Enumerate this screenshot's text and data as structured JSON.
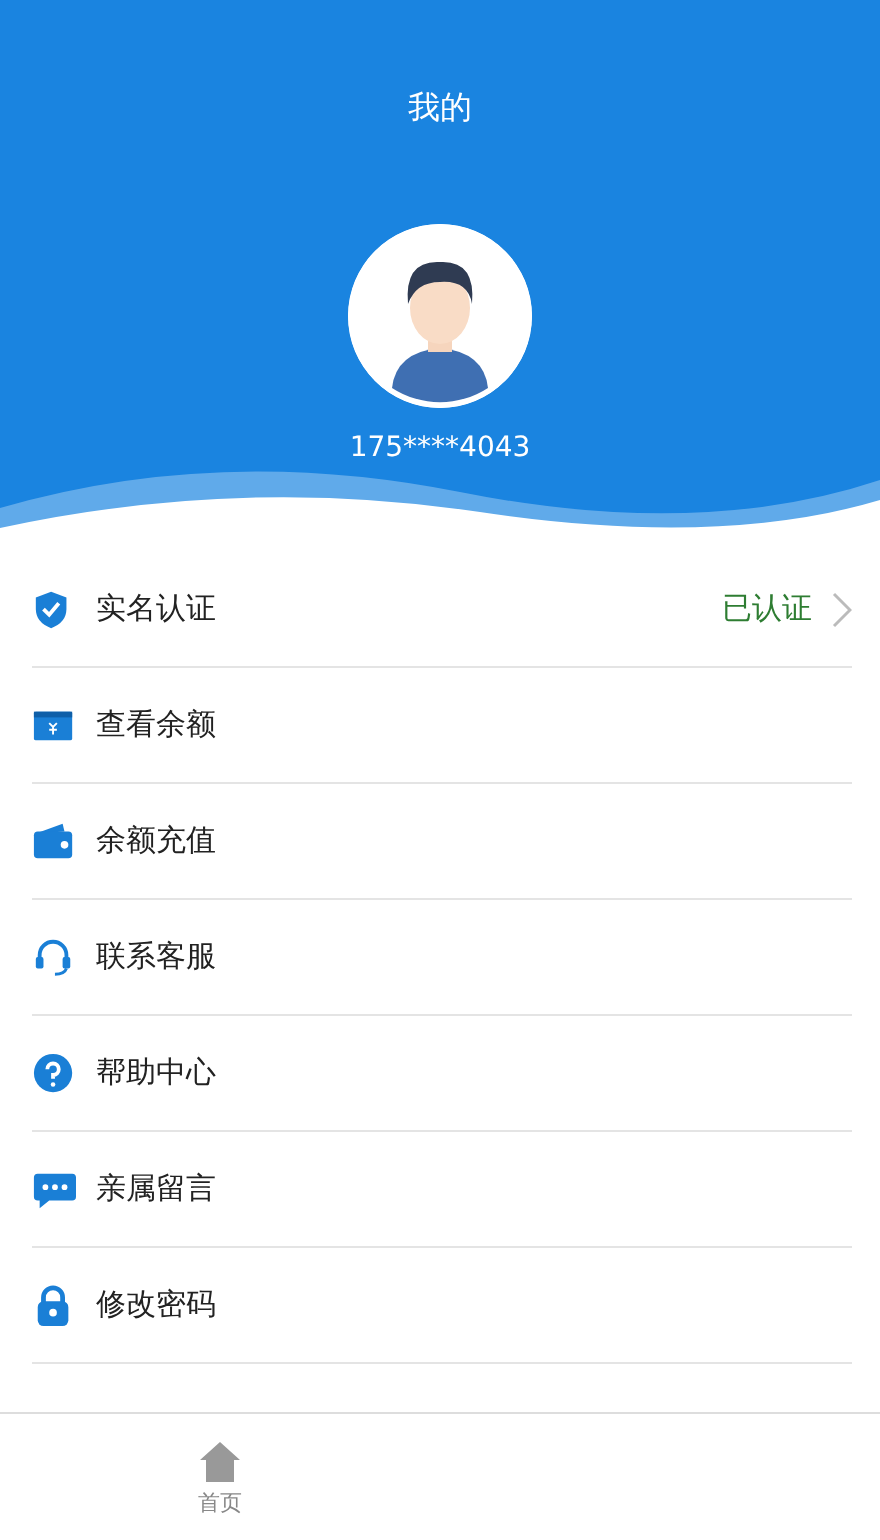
{
  "header": {
    "title": "我的",
    "phone": "175****4043"
  },
  "menu": [
    {
      "kind": "shield",
      "label": "实名认证",
      "status": "已认证",
      "chevron": true
    },
    {
      "kind": "card",
      "label": "查看余额"
    },
    {
      "kind": "wallet",
      "label": "余额充值"
    },
    {
      "kind": "headset",
      "label": "联系客服"
    },
    {
      "kind": "help",
      "label": "帮助中心"
    },
    {
      "kind": "chat",
      "label": "亲属留言"
    },
    {
      "kind": "lock",
      "label": "修改密码"
    }
  ],
  "bottom_nav": [
    {
      "kind": "home",
      "label": "首页",
      "selected": false
    }
  ]
}
